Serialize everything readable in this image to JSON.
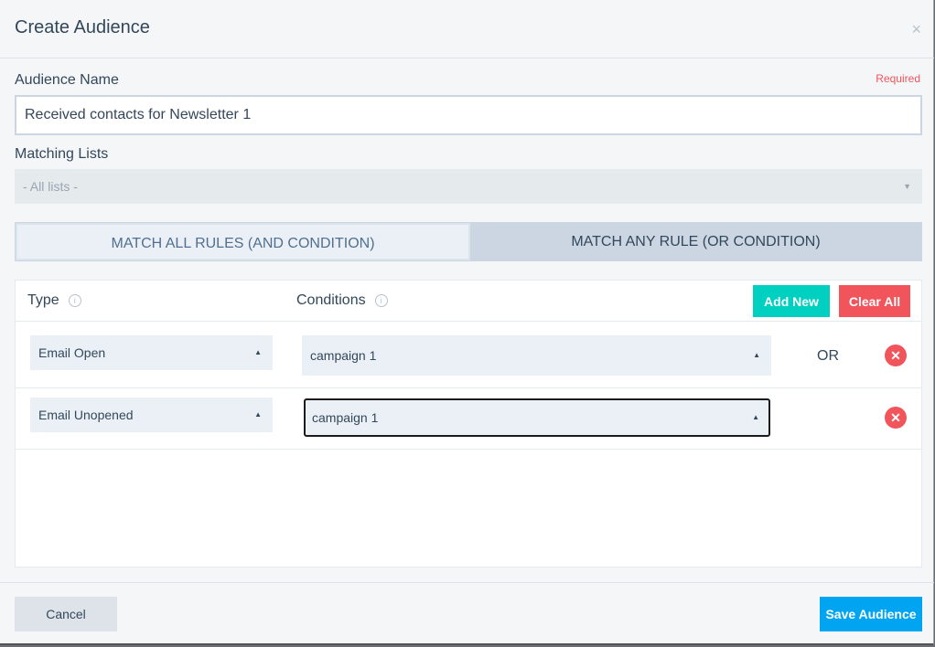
{
  "modal": {
    "title": "Create Audience",
    "close_icon": "×"
  },
  "audience_name": {
    "label": "Audience Name",
    "required_text": "Required",
    "value": "Received contacts for Newsletter 1"
  },
  "matching_lists": {
    "label": "Matching Lists",
    "selected": "- All lists -",
    "caret": "▼"
  },
  "match_toggle": {
    "all_label": "MATCH ALL RULES (AND CONDITION)",
    "any_label": "MATCH ANY RULE (OR CONDITION)",
    "active": "any"
  },
  "rules": {
    "type_header": "Type",
    "conditions_header": "Conditions",
    "info_icon": "i",
    "add_new_label": "Add New",
    "clear_all_label": "Clear All",
    "caret": "▲",
    "delete_icon": "✕",
    "rows": [
      {
        "type": "Email Open",
        "condition": "campaign 1",
        "connector": "OR"
      },
      {
        "type": "Email Unopened",
        "condition": "campaign 1",
        "connector": ""
      }
    ]
  },
  "footer": {
    "cancel_label": "Cancel",
    "save_label": "Save Audience"
  },
  "colors": {
    "accent_teal": "#00d0c0",
    "danger_red": "#f2545b",
    "primary_blue": "#00a4f0"
  }
}
